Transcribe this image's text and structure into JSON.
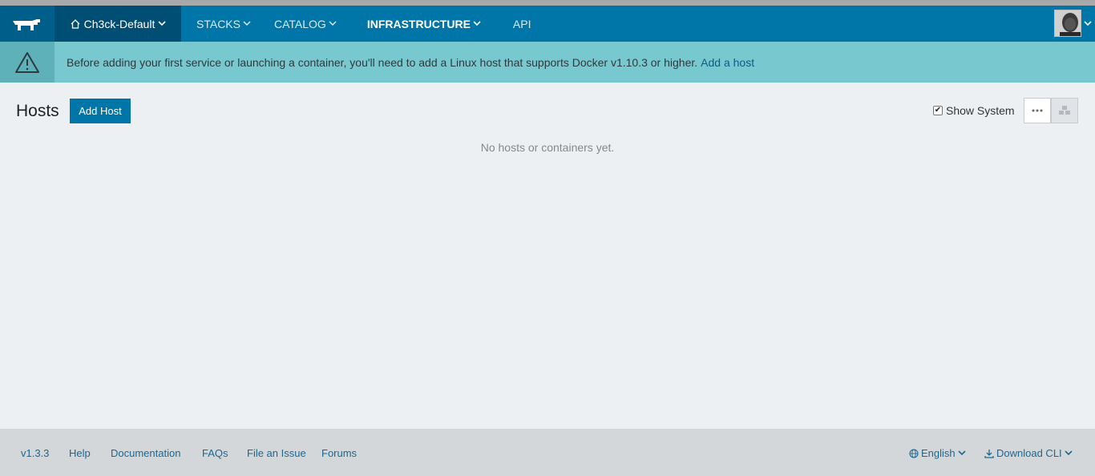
{
  "header": {
    "environment": "Ch3ck-Default",
    "nav": [
      {
        "label": "STACKS",
        "dropdown": true
      },
      {
        "label": "CATALOG",
        "dropdown": true
      },
      {
        "label": "INFRASTRUCTURE",
        "dropdown": true,
        "active": true
      },
      {
        "label": "API",
        "dropdown": false
      }
    ]
  },
  "banner": {
    "message": "Before adding your first service or launching a container, you'll need to add a Linux host that supports Docker v1.10.3 or higher.",
    "link": "Add a host"
  },
  "main": {
    "title": "Hosts",
    "add_button": "Add Host",
    "show_system_label": "Show System",
    "show_system_checked": true,
    "empty_message": "No hosts or containers yet."
  },
  "footer": {
    "version": "v1.3.3",
    "links": [
      "Help",
      "Documentation",
      "FAQs",
      "File an Issue",
      "Forums"
    ],
    "language": "English",
    "download": "Download CLI"
  },
  "colors": {
    "header_bg": "#0075a8",
    "env_bg": "#004e73",
    "banner_bg": "#78c8d0",
    "page_bg": "#edf0f2",
    "footer_bg": "#d3d7da"
  }
}
